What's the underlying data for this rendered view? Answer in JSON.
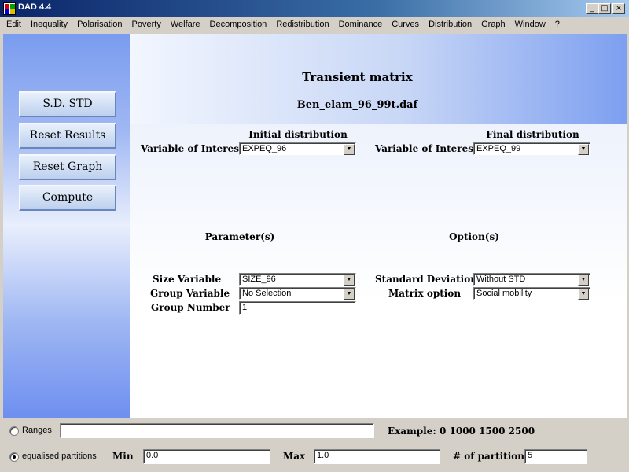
{
  "window": {
    "title": "DAD 4.4"
  },
  "menu": [
    "Edit",
    "Inequality",
    "Polarisation",
    "Poverty",
    "Welfare",
    "Decomposition",
    "Redistribution",
    "Dominance",
    "Curves",
    "Distribution",
    "Graph",
    "Window",
    "?"
  ],
  "sidebar": {
    "sd_std": "S.D. STD",
    "reset_results": "Reset Results",
    "reset_graph": "Reset Graph",
    "compute": "Compute"
  },
  "header": {
    "title": "Transient matrix",
    "filename": "Ben_elam_96_99t.daf"
  },
  "initial": {
    "heading": "Initial distribution",
    "var_label": "Variable of Interest",
    "var_value": "EXPEQ_96"
  },
  "final": {
    "heading": "Final distribution",
    "var_label": "Variable of Interest",
    "var_value": "EXPEQ_99"
  },
  "parameters": {
    "heading": "Parameter(s)",
    "size_label": "Size Variable",
    "size_value": "SIZE_96",
    "group_label": "Group Variable",
    "group_value": "No Selection",
    "group_number_label": "Group Number",
    "group_number_value": "1"
  },
  "options": {
    "heading": "Option(s)",
    "std_label": "Standard Deviation",
    "std_value": "Without STD",
    "matrix_label": "Matrix option",
    "matrix_value": "Social mobility"
  },
  "ranges": {
    "label": "Ranges",
    "value": "",
    "example": "Example: 0 1000 1500 2500"
  },
  "partitions": {
    "label": "equalised partitions",
    "min_label": "Min",
    "min_value": "0.0",
    "max_label": "Max",
    "max_value": "1.0",
    "count_label": "# of partitions",
    "count_value": "5"
  }
}
